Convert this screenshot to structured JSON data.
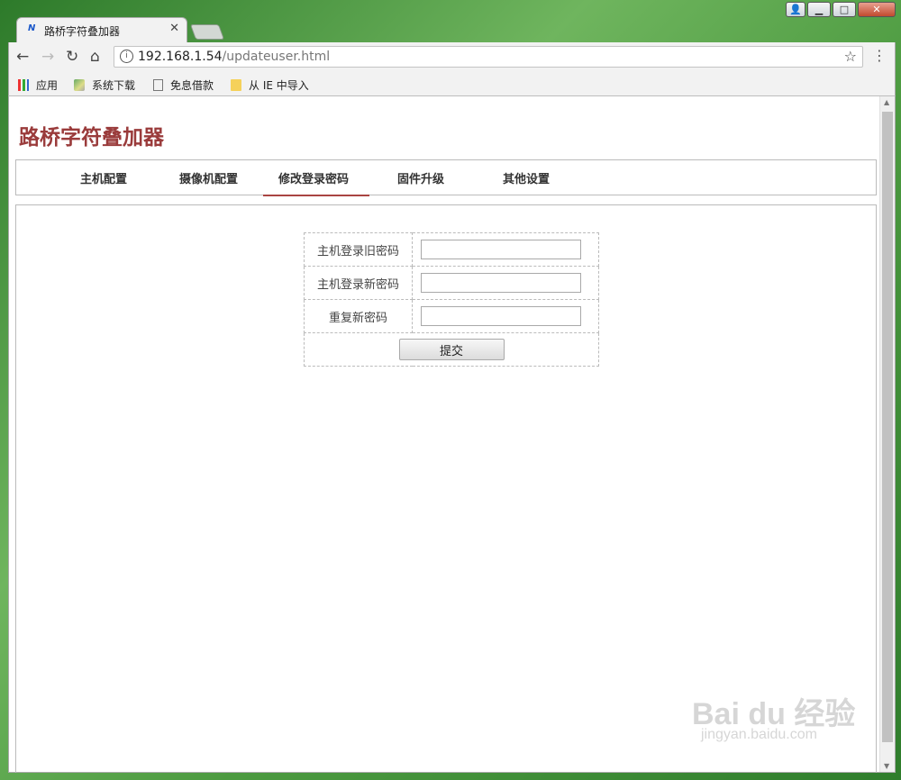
{
  "browser": {
    "tab_title": "路桥字符叠加器",
    "tab_favicon": "N",
    "url_host": "192.168.1.54",
    "url_path": "/updateuser.html",
    "bookmarks": [
      {
        "label": "应用",
        "icon": "apps-grid-icon"
      },
      {
        "label": "系统下载",
        "icon": "site-icon"
      },
      {
        "label": "免息借款",
        "icon": "page-icon"
      },
      {
        "label": "从 IE 中导入",
        "icon": "folder-icon"
      }
    ]
  },
  "site": {
    "title": "路桥字符叠加器"
  },
  "nav": {
    "items": [
      {
        "label": "主机配置",
        "active": false
      },
      {
        "label": "摄像机配置",
        "active": false
      },
      {
        "label": "修改登录密码",
        "active": true
      },
      {
        "label": "固件升级",
        "active": false
      },
      {
        "label": "其他设置",
        "active": false
      }
    ]
  },
  "form": {
    "old_password_label": "主机登录旧密码",
    "new_password_label": "主机登录新密码",
    "repeat_password_label": "重复新密码",
    "old_password_value": "",
    "new_password_value": "",
    "repeat_password_value": "",
    "submit_label": "提交"
  },
  "watermark": {
    "main": "Bai du 经验",
    "sub": "jingyan.baidu.com"
  },
  "colors": {
    "site_title": "#9a3b3b",
    "active_underline": "#a94442"
  }
}
